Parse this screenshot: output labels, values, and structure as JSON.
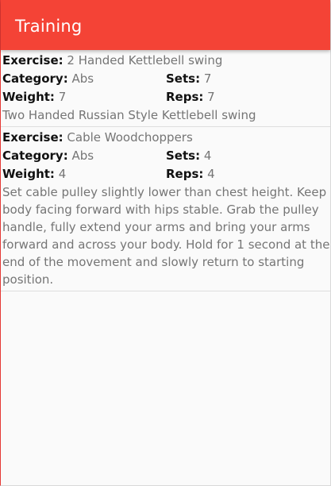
{
  "app_bar": {
    "title": "Training"
  },
  "labels": {
    "exercise": "Exercise:",
    "category": "Category:",
    "sets": "Sets:",
    "weight": "Weight:",
    "reps": "Reps:"
  },
  "exercises": [
    {
      "name": "2 Handed Kettlebell swing",
      "category": "Abs",
      "sets": "7",
      "weight": "7",
      "reps": "7",
      "description": "Two Handed Russian Style Kettlebell swing"
    },
    {
      "name": "Cable Woodchoppers",
      "category": "Abs",
      "sets": "4",
      "weight": "4",
      "reps": "4",
      "description": "Set cable pulley slightly lower than chest height. Keep body facing forward with hips stable.  Grab the pulley handle, fully extend your arms and bring your arms forward and across your body. Hold for 1 second at the end of the movement and slowly return to starting position."
    }
  ]
}
